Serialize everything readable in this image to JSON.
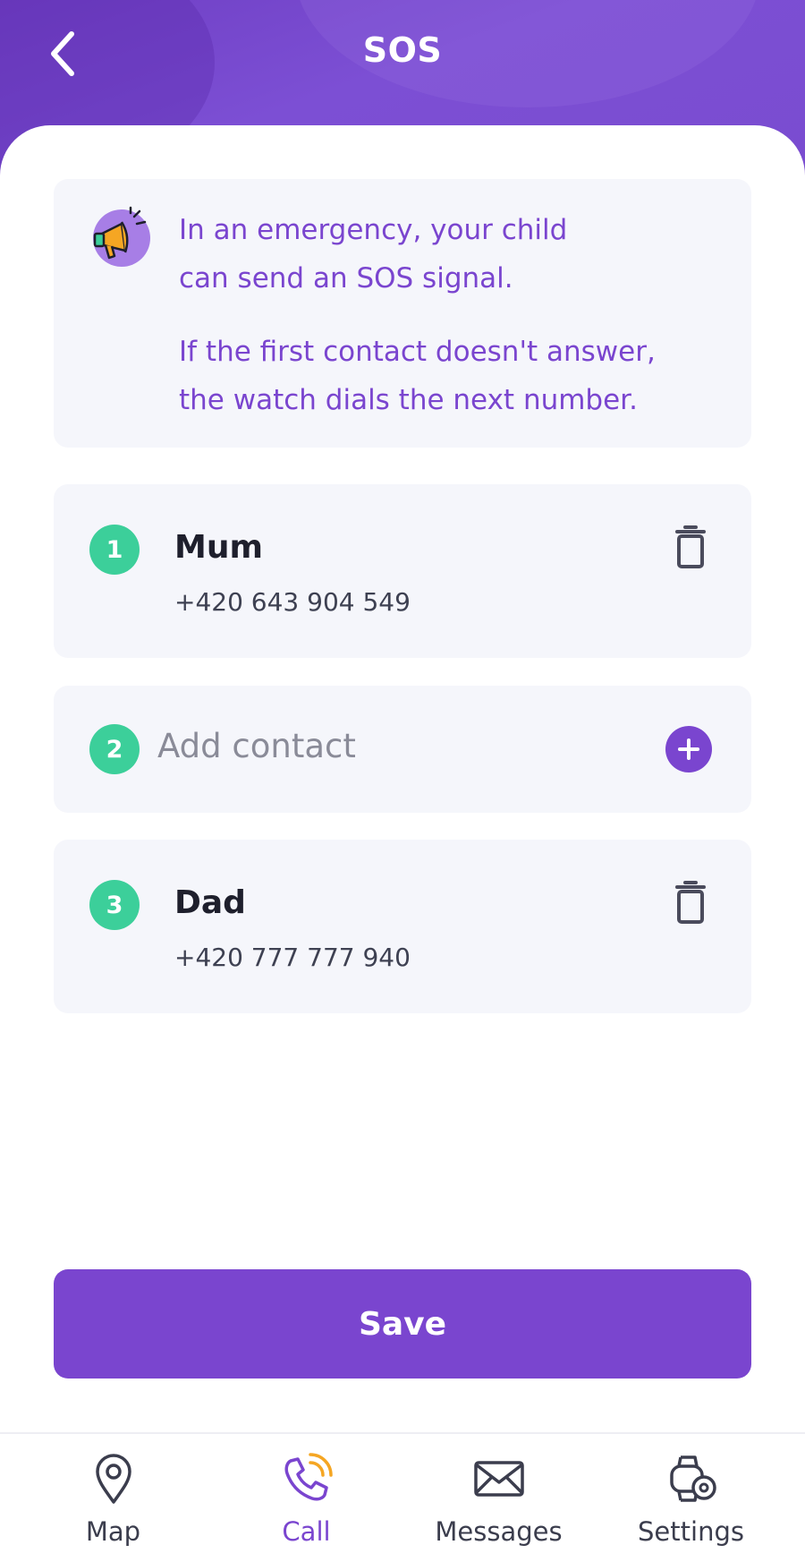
{
  "header": {
    "title": "SOS",
    "back_icon": "chevron-left-icon"
  },
  "info": {
    "icon": "megaphone-icon",
    "line1a": "In an emergency, your child",
    "line1b": "can send an SOS signal.",
    "line2a": "If the first contact doesn't answer,",
    "line2b": "the watch dials the next number."
  },
  "contacts": [
    {
      "number": "1",
      "name": "Mum",
      "phone": "+420 643 904 549"
    },
    {
      "number": "2",
      "add_label": "Add contact"
    },
    {
      "number": "3",
      "name": "Dad",
      "phone": "+420 777 777 940"
    }
  ],
  "save_label": "Save",
  "tabs": [
    {
      "label": "Map",
      "icon": "map-pin-icon"
    },
    {
      "label": "Call",
      "icon": "phone-call-icon",
      "active": true
    },
    {
      "label": "Messages",
      "icon": "envelope-icon"
    },
    {
      "label": "Settings",
      "icon": "watch-settings-icon"
    }
  ],
  "colors": {
    "accent": "#7a45cf",
    "badge": "#3ccf9a",
    "card": "#f5f6fb",
    "megaphone": "#f5a623"
  }
}
